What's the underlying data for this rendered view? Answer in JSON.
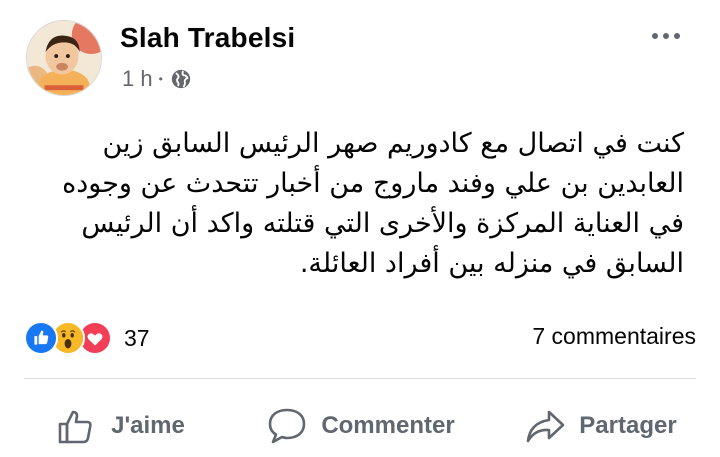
{
  "post": {
    "author": "Slah Trabelsi",
    "time": "1 h",
    "separator": "•",
    "audience_icon": "globe-icon",
    "more_icon": "more-options-icon",
    "text_lines": [
      "كنت في اتصال مع كادوريم صهر الرئيس السابق زين",
      "العابدين بن علي وفند ماروج من أخبار تتحدث عن وجوده",
      "في العناية المركزة والأخرى التي قتلته واكد أن الرئيس",
      "السابق في منزله بين أفراد العائلة."
    ]
  },
  "engagement": {
    "reaction_icons": [
      "like-icon",
      "wow-icon",
      "love-icon"
    ],
    "reaction_count": "37",
    "comment_count": "7 commentaires"
  },
  "actions": [
    {
      "label": "J'aime",
      "icon": "thumbs-up-icon"
    },
    {
      "label": "Commenter",
      "icon": "comment-icon"
    },
    {
      "label": "Partager",
      "icon": "share-icon"
    }
  ],
  "colors": {
    "like_blue": "#1877f2",
    "love_red": "#f33e58",
    "wow_yellow": "#f7b928",
    "secondary_text": "#65676b"
  }
}
